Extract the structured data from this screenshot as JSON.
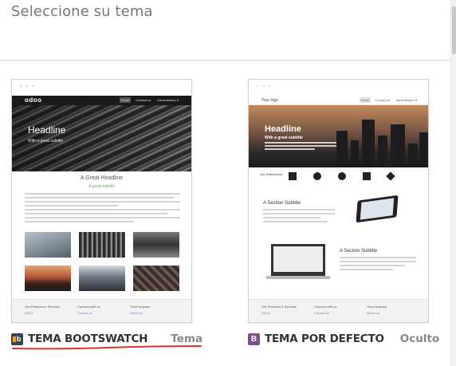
{
  "header": {
    "title": "Seleccione su tema"
  },
  "colors": {
    "accent_red": "#d9342b",
    "bootswatch_badge": "#3a4450",
    "default_badge": "#7b4f8e"
  },
  "themes": [
    {
      "name": "TEMA BOOTSWATCH",
      "tag": "Tema",
      "icon": "bootswatch-logo-icon",
      "preview": {
        "dots": "• • •",
        "logo": "odoo",
        "menu": [
          "Home",
          "Contact us",
          "Administrator ▾"
        ],
        "headline": "Headline",
        "subtitle": "With a great subtitle",
        "section_title": "A Great Headline",
        "section_subtitle": "A good subtitle",
        "footer_cols": [
          "Our Products & Services",
          "Connect with us",
          "YourCompany"
        ],
        "footer_links": [
          "Home",
          "Contact us",
          "About us"
        ]
      }
    },
    {
      "name": "TEMA POR DEFECTO",
      "tag": "Oculto",
      "icon_letter": "B",
      "preview": {
        "dots": "• • •",
        "logo": "Your logo",
        "menu": [
          "Home",
          "Contact us",
          "Administrator ▾"
        ],
        "headline": "Headline",
        "subtitle": "With a great subtitle",
        "references": "Our References",
        "section1": "A Section Subtitle",
        "section2": "A Section Subtitle",
        "footer_cols": [
          "Our Products & Services",
          "Connect with us",
          "YourCompany"
        ],
        "footer_links": [
          "Home",
          "Contact us",
          "About us"
        ]
      }
    }
  ]
}
